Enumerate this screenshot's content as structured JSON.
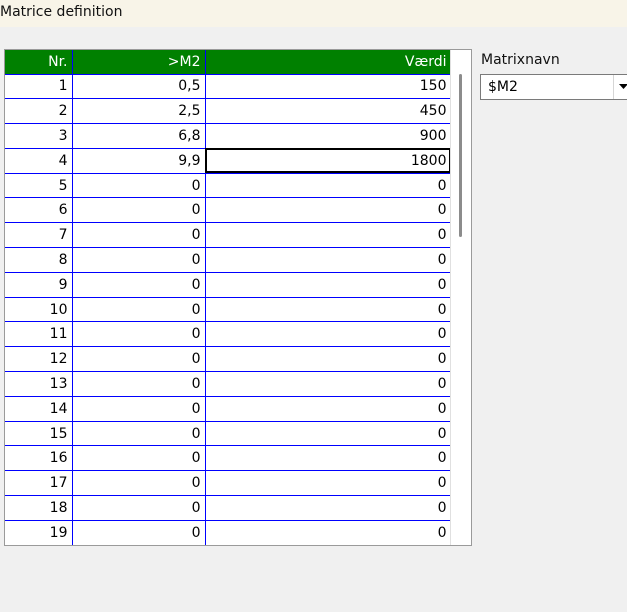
{
  "window": {
    "title": "Matrice definition"
  },
  "grid": {
    "columns": [
      "Nr.",
      ">M2",
      "Værdi"
    ],
    "rows": [
      [
        "1",
        "0,5",
        "150"
      ],
      [
        "2",
        "2,5",
        "450"
      ],
      [
        "3",
        "6,8",
        "900"
      ],
      [
        "4",
        "9,9",
        "1800"
      ],
      [
        "5",
        "0",
        "0"
      ],
      [
        "6",
        "0",
        "0"
      ],
      [
        "7",
        "0",
        "0"
      ],
      [
        "8",
        "0",
        "0"
      ],
      [
        "9",
        "0",
        "0"
      ],
      [
        "10",
        "0",
        "0"
      ],
      [
        "11",
        "0",
        "0"
      ],
      [
        "12",
        "0",
        "0"
      ],
      [
        "13",
        "0",
        "0"
      ],
      [
        "14",
        "0",
        "0"
      ],
      [
        "15",
        "0",
        "0"
      ],
      [
        "16",
        "0",
        "0"
      ],
      [
        "17",
        "0",
        "0"
      ],
      [
        "18",
        "0",
        "0"
      ],
      [
        "19",
        "0",
        "0"
      ]
    ],
    "header_color": "#008000",
    "line_color": "#0000ff"
  },
  "matrix_name": {
    "label": "Matrixnavn",
    "value": "$M2"
  }
}
